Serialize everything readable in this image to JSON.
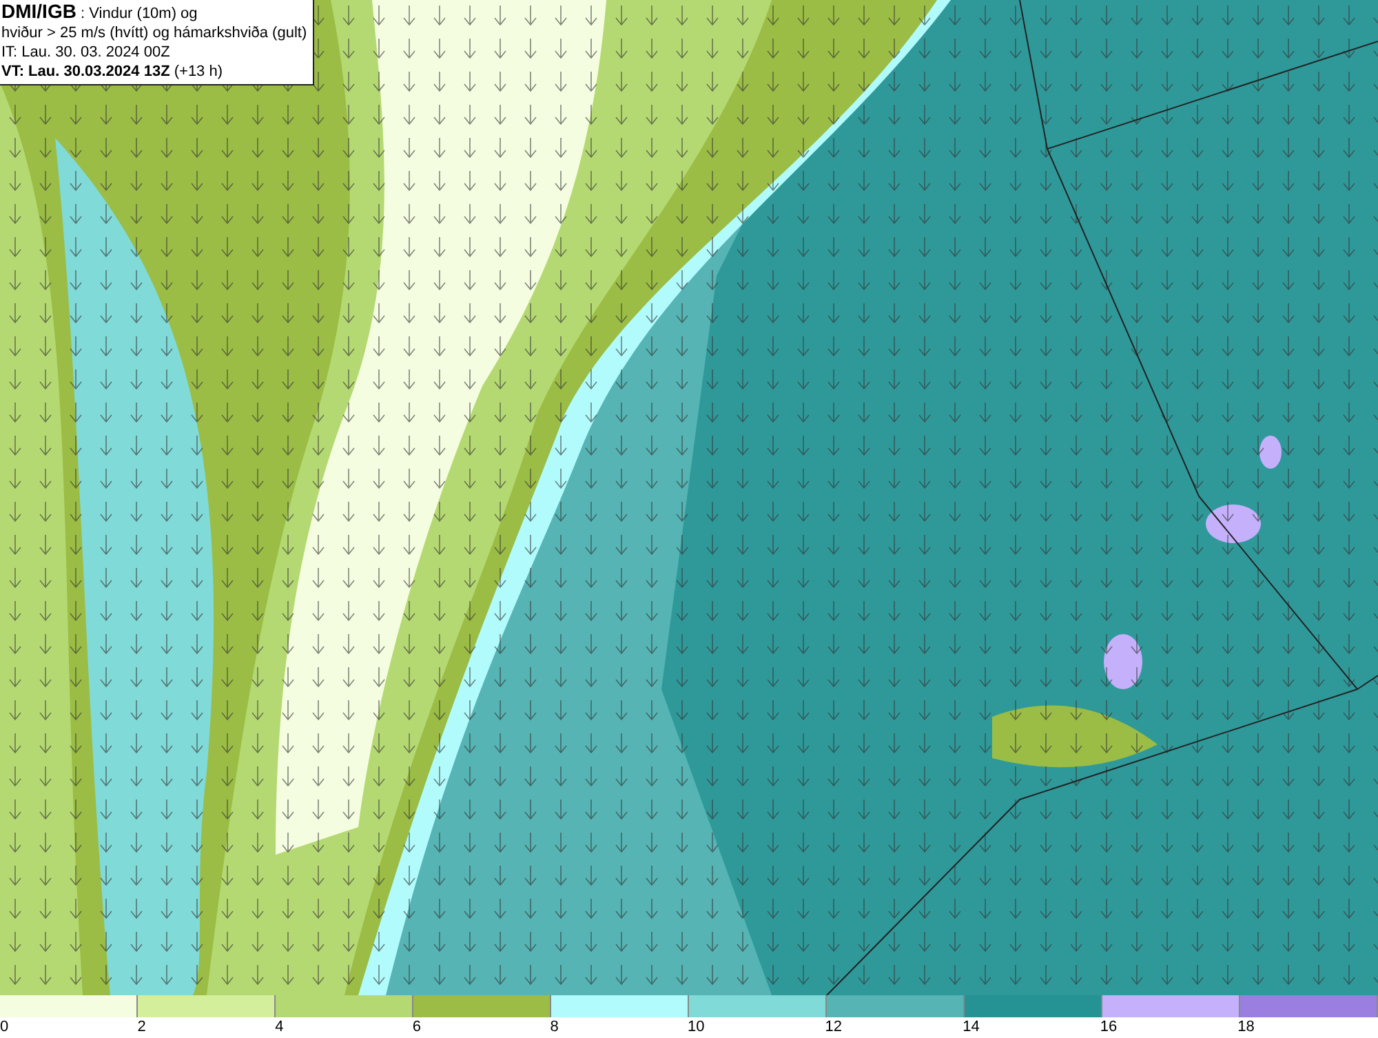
{
  "info_box": {
    "lines": [
      "**DMI/IGB** : Vindur (10m) og",
      "hviður > 25 m/s (hvítt) og hámarkshviða (gult)",
      "IT: Lau. 30. 03. 2024 00Z",
      "**VT: Lau. 30.03.2024 13Z** (+13 h)"
    ]
  },
  "legend": {
    "bins": [
      {
        "label": "0",
        "color": "#f5fde0"
      },
      {
        "label": "2",
        "color": "#d4ef9c"
      },
      {
        "label": "4",
        "color": "#b5d972"
      },
      {
        "label": "6",
        "color": "#9bbd45"
      },
      {
        "label": "8",
        "color": "#b1fbfc"
      },
      {
        "label": "10",
        "color": "#80dad8"
      },
      {
        "label": "12",
        "color": "#56b4b4"
      },
      {
        "label": "14",
        "color": "#259294"
      },
      {
        "label": "16",
        "color": "#c5b0fc"
      },
      {
        "label": "18",
        "color": "#9a7fe0"
      }
    ]
  }
}
